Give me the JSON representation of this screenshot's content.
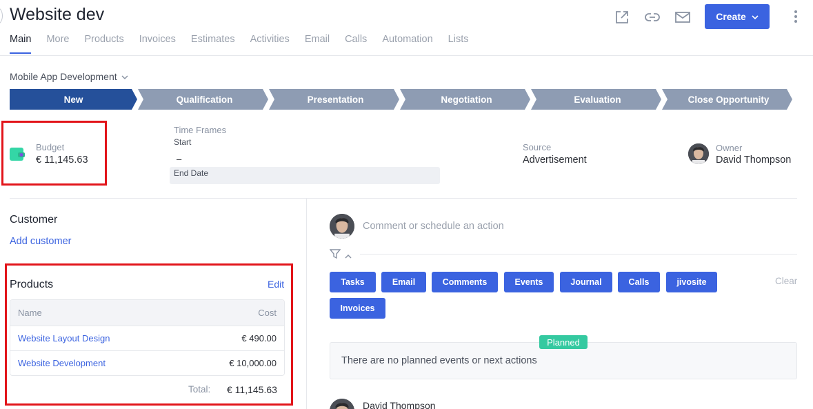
{
  "header": {
    "title": "Website dev",
    "create_label": "Create"
  },
  "tabs": [
    "Main",
    "More",
    "Products",
    "Invoices",
    "Estimates",
    "Activities",
    "Email",
    "Calls",
    "Automation",
    "Lists"
  ],
  "pipeline": {
    "selected": "Mobile App Development"
  },
  "stages": [
    {
      "label": "New",
      "active": true
    },
    {
      "label": "Qualification",
      "active": false
    },
    {
      "label": "Presentation",
      "active": false
    },
    {
      "label": "Negotiation",
      "active": false
    },
    {
      "label": "Evaluation",
      "active": false
    },
    {
      "label": "Close Opportunity",
      "active": false
    }
  ],
  "colors": {
    "accent": "#3b63e0",
    "stage_active": "#25509a",
    "stage_inactive": "#8e9cb3",
    "planned": "#34c9a0",
    "highlight": "#e2141a"
  },
  "info": {
    "budget_label": "Budget",
    "budget_value": "€ 11,145.63",
    "timeframes_label": "Time Frames",
    "start_label": "Start",
    "start_value": "–",
    "end_label": "End Date",
    "source_label": "Source",
    "source_value": "Advertisement",
    "owner_label": "Owner",
    "owner_value": "David Thompson"
  },
  "customer": {
    "title": "Customer",
    "add_label": "Add customer"
  },
  "products": {
    "title": "Products",
    "edit_label": "Edit",
    "col_name": "Name",
    "col_cost": "Cost",
    "rows": [
      {
        "name": "Website Layout Design",
        "cost": "€ 490.00"
      },
      {
        "name": "Website Development",
        "cost": "€ 10,000.00"
      }
    ],
    "total_label": "Total:",
    "total_value": "€ 11,145.63"
  },
  "activity": {
    "comment_placeholder": "Comment or schedule an action",
    "filters": [
      "Tasks",
      "Email",
      "Comments",
      "Events",
      "Journal",
      "Calls",
      "jivosite",
      "Invoices"
    ],
    "clear_label": "Clear",
    "planned_badge": "Planned",
    "planned_empty": "There are no planned events or next actions",
    "feed_author": "David Thompson"
  },
  "icons": {
    "external": "external-link-icon",
    "link": "link-icon",
    "mail": "mail-icon",
    "filter": "filter-icon",
    "wallet": "wallet-icon"
  }
}
